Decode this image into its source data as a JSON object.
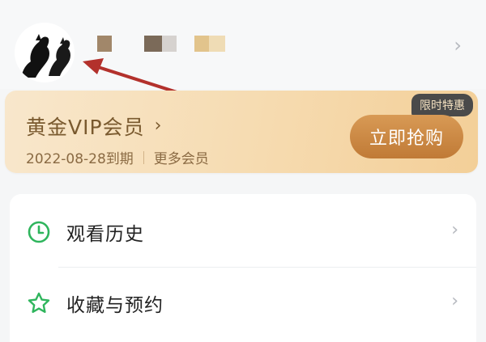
{
  "profile": {
    "avatar_label": "avatar",
    "chevron": "›"
  },
  "vip": {
    "title": "黄金VIP会员",
    "title_chevron": "›",
    "expiry": "2022-08-28到期",
    "more": "更多会员",
    "badge": "限时特惠",
    "buy_label": "立即抢购"
  },
  "menu": {
    "items": [
      {
        "label": "观看历史",
        "icon": "clock-icon",
        "chevron": "›"
      },
      {
        "label": "收藏与预约",
        "icon": "star-icon",
        "chevron": "›"
      }
    ]
  },
  "colors": {
    "accent_green": "#2fb55d",
    "vip_text": "#7a5a2f",
    "buy_button": "#c98a45",
    "annotation_arrow": "#b3312c"
  }
}
